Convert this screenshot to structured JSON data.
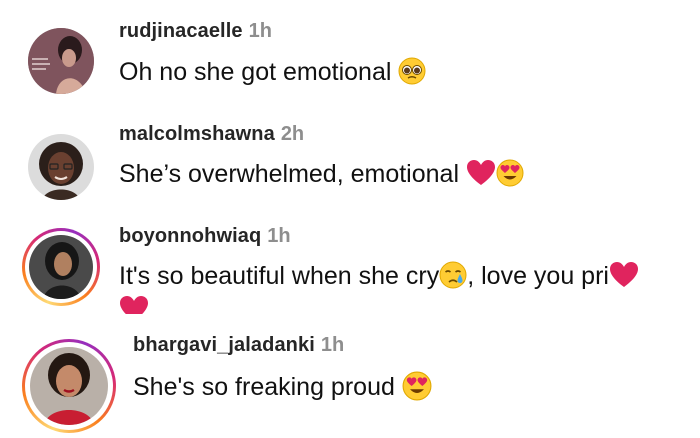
{
  "comments": [
    {
      "username": "rudjinacaelle",
      "time": "1h",
      "text": "Oh no she got emotional",
      "emojis": [
        "pleading-face"
      ],
      "story_ring": false
    },
    {
      "username": "malcolmshawna",
      "time": "2h",
      "text": "She’s overwhelmed, emotional",
      "emojis": [
        "red-heart",
        "heart-eyes-face"
      ],
      "story_ring": false
    },
    {
      "username": "boyonnohwiaq",
      "time": "1h",
      "text_part1": "It's so beautiful when she cry",
      "text_part2": ", love you pri",
      "emojis": [
        "crying-face",
        "red-heart",
        "red-heart"
      ],
      "story_ring": true
    },
    {
      "username": "bhargavi_jaladanki",
      "time": "1h",
      "text": "She's so freaking proud ",
      "emojis": [
        "heart-eyes-face"
      ],
      "story_ring": true
    }
  ],
  "colors": {
    "username": "#262626",
    "timestamp": "#8e8e8e",
    "heart": "#e0245e",
    "emoji_yellow": "#ffcc33"
  }
}
